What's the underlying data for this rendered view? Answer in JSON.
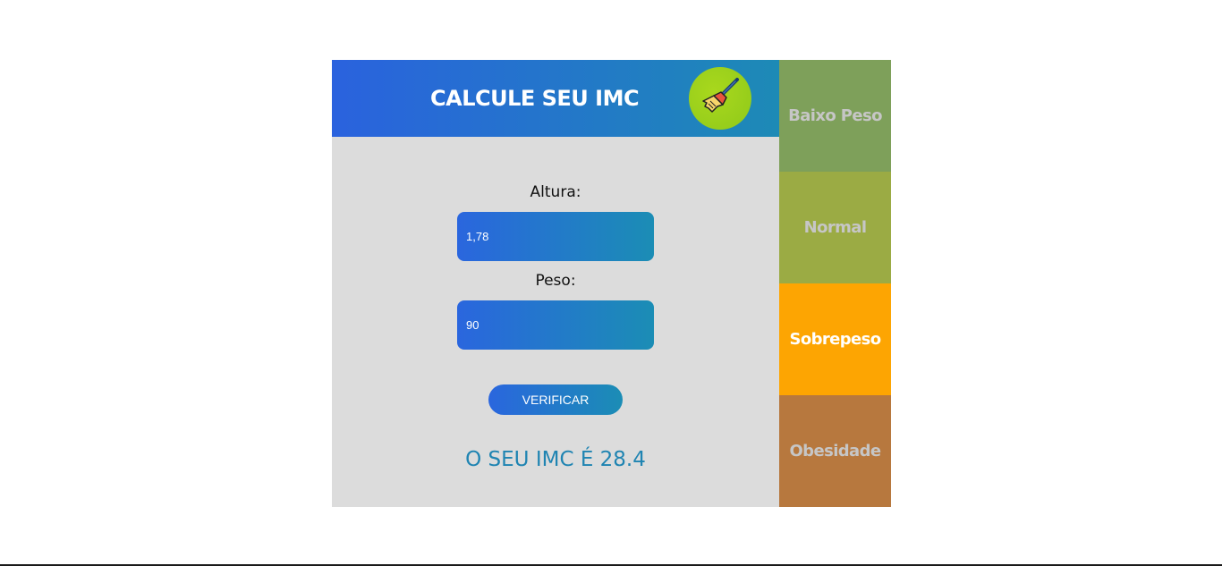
{
  "header": {
    "title": "CALCULE SEU IMC",
    "clear_icon": "broom-icon"
  },
  "form": {
    "height_label": "Altura:",
    "height_value": "1,78",
    "weight_label": "Peso:",
    "weight_value": "90",
    "verify_label": "VERIFICAR"
  },
  "result": {
    "text": "O SEU IMC É 28.4"
  },
  "categories": [
    {
      "label": "Baixo Peso",
      "color": "#7ea05a",
      "active": false
    },
    {
      "label": "Normal",
      "color": "#9bab44",
      "active": false
    },
    {
      "label": "Sobrepeso",
      "color": "#fda502",
      "active": true
    },
    {
      "label": "Obesidade",
      "color": "#b7783e",
      "active": false
    }
  ],
  "colors": {
    "accent_start": "#2a62de",
    "accent_end": "#1d8ab6",
    "panel_bg": "#dcdcdc",
    "result_text": "#1f84b2",
    "clear_button": "#9ccf1c"
  }
}
